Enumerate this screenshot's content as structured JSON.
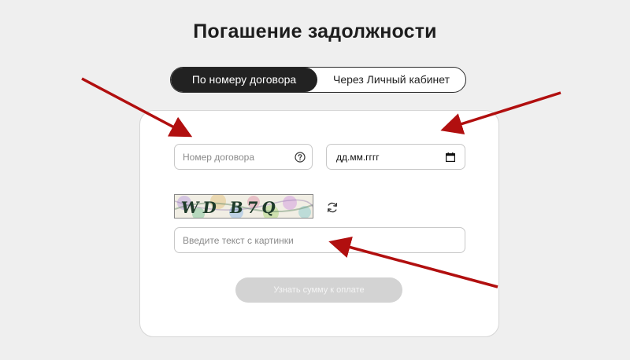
{
  "page": {
    "title": "Погашение задолжности"
  },
  "tabs": [
    {
      "label": "По номеру договора",
      "active": true
    },
    {
      "label": "Через Личный кабинет",
      "active": false
    }
  ],
  "form": {
    "contract_placeholder": "Номер договора",
    "date_value": "дд.мм.гггг",
    "captcha_text": "WD B7Q",
    "captcha_placeholder": "Введите текст с картинки",
    "submit_label": "Узнать сумму к оплате"
  },
  "colors": {
    "accent_arrow": "#b10f0f",
    "active_tab_bg": "#222222",
    "disabled_button_bg": "#d3d3d3"
  },
  "icons": [
    "help-icon",
    "calendar-icon",
    "refresh-icon"
  ]
}
